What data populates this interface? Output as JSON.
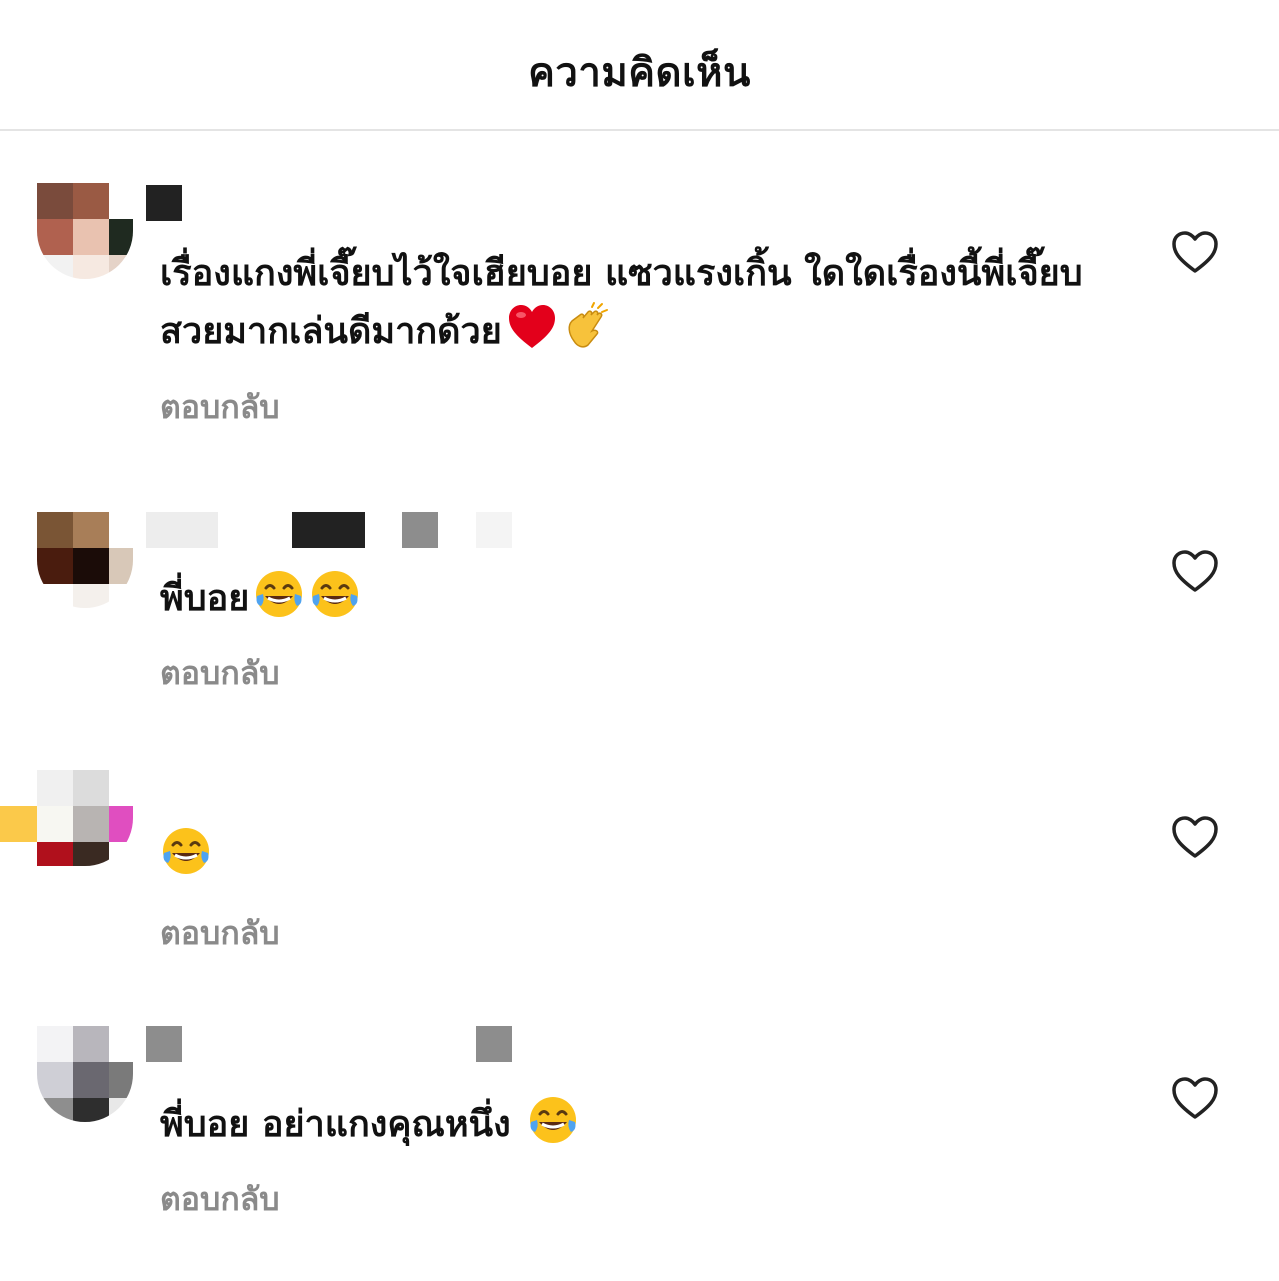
{
  "header": {
    "title": "ความคิดเห็น"
  },
  "comments": [
    {
      "text": "เรื่องแกงพี่เจี๊ยบไว้ใจเฮียบอย แซวแรงเกิ้น ใดใดเรื่องนี้พี่เจี๊ยบสวยมากเล่นดีมากด้วย",
      "emojis": [
        "red-heart-emoji",
        "clapping-hands-emoji"
      ],
      "reply_label": "ตอบกลับ"
    },
    {
      "text": "พี่บอย",
      "emojis": [
        "tears-of-joy-emoji",
        "tears-of-joy-emoji"
      ],
      "reply_label": "ตอบกลับ"
    },
    {
      "text": "",
      "emojis": [
        "tears-of-joy-emoji"
      ],
      "reply_label": "ตอบกลับ"
    },
    {
      "text": "พี่บอย อย่าแกงคุณหนึ่ง ",
      "emojis": [
        "tears-of-joy-emoji"
      ],
      "reply_label": "ตอบกลับ"
    }
  ],
  "colors": {
    "text": "#111111",
    "reply": "#8a8a8a",
    "divider": "#e4e4e4",
    "heart_outline": "#222222"
  }
}
